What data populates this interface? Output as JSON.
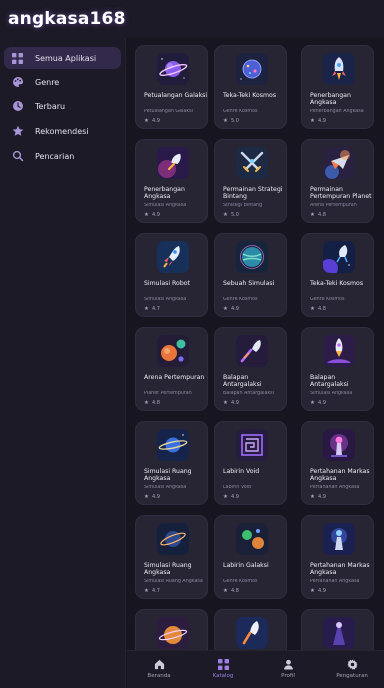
{
  "app": {
    "title": "angkasa168"
  },
  "sidebar": {
    "items": [
      {
        "label": "Semua Aplikasi",
        "icon": "grid-icon",
        "active": true
      },
      {
        "label": "Genre",
        "icon": "palette-icon",
        "active": false
      },
      {
        "label": "Terbaru",
        "icon": "clock-icon",
        "active": false
      },
      {
        "label": "Rekomendesi",
        "icon": "star-icon",
        "active": false
      },
      {
        "label": "Pencarian",
        "icon": "search-icon",
        "active": false
      }
    ]
  },
  "cards": [
    {
      "title": "Petualangan Galaksi",
      "category": "Petualangan Galaksi",
      "rating": "4.9",
      "art": "planet-ring"
    },
    {
      "title": "Teka-Teki Kosmos",
      "category": "Genre Kosmos",
      "rating": "5.0",
      "art": "planet-dots"
    },
    {
      "title": "Penerbangan Angkasa",
      "category": "Penerbangan Angkasa",
      "rating": "4.9",
      "art": "rocket"
    },
    {
      "title": "Penerbangan Angkasa",
      "category": "Simulasi Angkasa",
      "rating": "4.9",
      "art": "rocket-nebula"
    },
    {
      "title": "Permainan Strategi Bintang",
      "category": "Strategi Bintang",
      "rating": "5.0",
      "art": "swords"
    },
    {
      "title": "Permainan Pertempuran Planet",
      "category": "Arena Pertempuran",
      "rating": "4.8",
      "art": "spaceship"
    },
    {
      "title": "Simulasi Robot",
      "category": "Simulasi Angkasa",
      "rating": "4.7",
      "art": "rocket-blue"
    },
    {
      "title": "Sebuah Simulasi",
      "category": "Genre Kosmos",
      "rating": "4.9",
      "art": "planet-glow"
    },
    {
      "title": "Teka-Teki Kosmos",
      "category": "Genre Kosmos",
      "rating": "4.8",
      "art": "rocket-planet"
    },
    {
      "title": "Arena Pertempuran",
      "category": "Planet Pertempuran",
      "rating": "4.8",
      "art": "planets"
    },
    {
      "title": "Balapan Antargalaksi",
      "category": "Balapan Antargalaksi",
      "rating": "4.9",
      "art": "rocket-trail"
    },
    {
      "title": "Balapan Antargalaksi",
      "category": "Simulasi Angkasa",
      "rating": "4.9",
      "art": "rocket-launch"
    },
    {
      "title": "Simulasi Ruang Angkasa",
      "category": "Simulasi Angkasa",
      "rating": "4.9",
      "art": "planet-ring-blue"
    },
    {
      "title": "Labirin Void",
      "category": "Labirin Void",
      "rating": "4.9",
      "art": "maze"
    },
    {
      "title": "Pertahanan Markas Angkasa",
      "category": "Pertahanan Angkasa",
      "rating": "4.9",
      "art": "tower"
    },
    {
      "title": "Simulasi Ruang Angkasa",
      "category": "Simulasi Ruang Angkasa",
      "rating": "4.7",
      "art": "planet-dark"
    },
    {
      "title": "Labirin Galaksi",
      "category": "Genre Kosmos",
      "rating": "4.8",
      "art": "planets-small"
    },
    {
      "title": "Pertahanan Markas Angkasa",
      "category": "Pertahanan Angkasa",
      "rating": "4.9",
      "art": "tower-blue"
    },
    {
      "title": "",
      "category": "",
      "rating": "",
      "art": "planet-orange"
    },
    {
      "title": "",
      "category": "",
      "rating": "",
      "art": "rocket-orange"
    },
    {
      "title": "",
      "category": "",
      "rating": "",
      "art": "beacon"
    }
  ],
  "bottom_nav": {
    "items": [
      {
        "label": "Beranda",
        "icon": "home-icon",
        "active": false
      },
      {
        "label": "Katalog",
        "icon": "grid-icon",
        "active": true
      },
      {
        "label": "Profil",
        "icon": "person-icon",
        "active": false
      },
      {
        "label": "Pengaturan",
        "icon": "gear-icon",
        "active": false
      }
    ]
  },
  "colors": {
    "background": "#17151f",
    "card": "#272433",
    "accent": "#9d80e6",
    "active_nav": "#33294a"
  }
}
